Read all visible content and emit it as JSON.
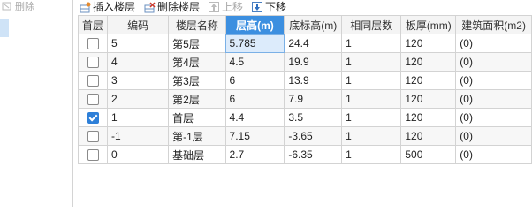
{
  "left": {
    "delete_label": "删除"
  },
  "toolbar": {
    "insert_label": "插入楼层",
    "delete_label": "删除楼层",
    "up_label": "上移",
    "down_label": "下移"
  },
  "table": {
    "headers": [
      "首层",
      "编码",
      "楼层名称",
      "层高(m)",
      "底标高(m)",
      "相同层数",
      "板厚(mm)",
      "建筑面积(m2)"
    ],
    "active_header_index": 3,
    "rows": [
      {
        "checked": false,
        "code": "5",
        "name": "第5层",
        "height": "5.785",
        "bottom": "24.4",
        "same": "1",
        "thick": "120",
        "area": "(0)"
      },
      {
        "checked": false,
        "code": "4",
        "name": "第4层",
        "height": "4.5",
        "bottom": "19.9",
        "same": "1",
        "thick": "120",
        "area": "(0)"
      },
      {
        "checked": false,
        "code": "3",
        "name": "第3层",
        "height": "6",
        "bottom": "13.9",
        "same": "1",
        "thick": "120",
        "area": "(0)"
      },
      {
        "checked": false,
        "code": "2",
        "name": "第2层",
        "height": "6",
        "bottom": "7.9",
        "same": "1",
        "thick": "120",
        "area": "(0)"
      },
      {
        "checked": true,
        "code": "1",
        "name": "首层",
        "height": "4.4",
        "bottom": "3.5",
        "same": "1",
        "thick": "120",
        "area": "(0)"
      },
      {
        "checked": false,
        "code": "-1",
        "name": "第-1层",
        "height": "7.15",
        "bottom": "-3.65",
        "same": "1",
        "thick": "120",
        "area": "(0)"
      },
      {
        "checked": false,
        "code": "0",
        "name": "基础层",
        "height": "2.7",
        "bottom": "-6.35",
        "same": "1",
        "thick": "500",
        "area": "(0)"
      }
    ]
  },
  "colors": {
    "active_header": "#3c8fe0",
    "checkbox_checked": "#2d7fd8",
    "selected_cell": "#dcebfb"
  }
}
